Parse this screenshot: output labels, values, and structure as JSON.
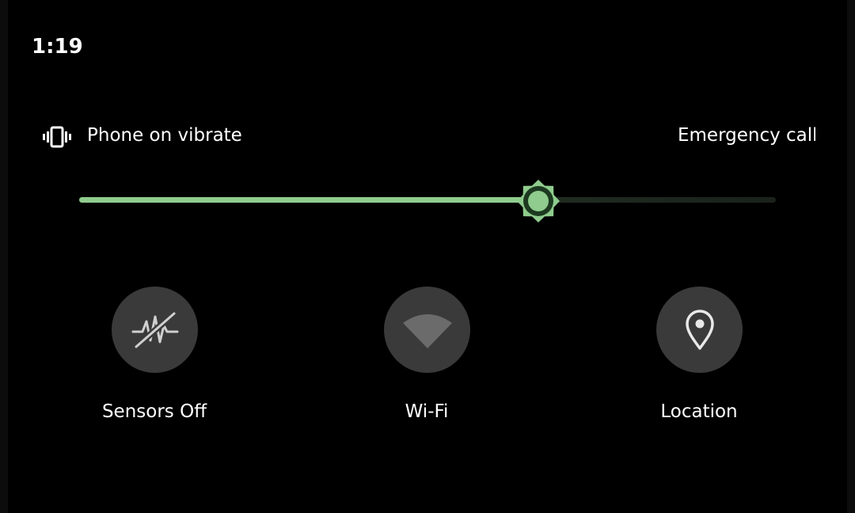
{
  "status_bar": {
    "time": "1:19"
  },
  "header": {
    "vibrate_icon": "vibrate-icon",
    "ringer_status": "Phone on vibrate",
    "emergency_text": "Emergency calls"
  },
  "brightness": {
    "level": 0.659,
    "thumb_icon": "brightness-sun-icon",
    "accent_color": "#8fcc8d"
  },
  "tiles": [
    {
      "label": "Sensors Off",
      "icon": "sensors-off-icon"
    },
    {
      "label": "Wi-Fi",
      "icon": "wifi-icon"
    },
    {
      "label": "Location",
      "icon": "location-pin-icon"
    }
  ]
}
